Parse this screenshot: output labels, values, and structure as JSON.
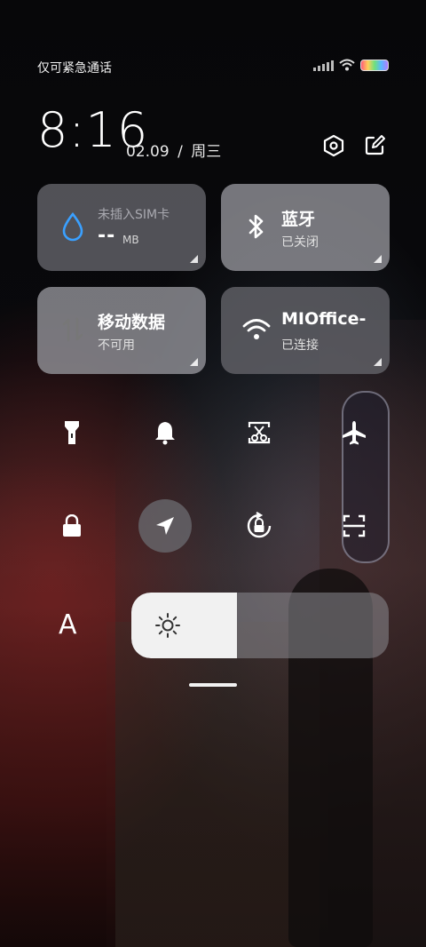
{
  "status_bar": {
    "carrier_text": "仅可紧急通话",
    "icons": [
      "signal-icon",
      "wifi-icon",
      "battery-icon"
    ]
  },
  "header": {
    "time": "8:16",
    "date": "02.09",
    "separator": "/",
    "weekday": "周三",
    "buttons": [
      "settings-icon",
      "edit-icon"
    ]
  },
  "tiles": {
    "sim": {
      "title": "未插入SIM卡",
      "value": "--",
      "unit": "MB",
      "icon": "water-drop-icon",
      "accent": "#3aa0ff"
    },
    "bluetooth": {
      "title": "蓝牙",
      "status": "已关闭",
      "icon": "bluetooth-icon"
    },
    "mobile_data": {
      "title": "移动数据",
      "status": "不可用",
      "icon": "data-arrows-icon"
    },
    "wlan": {
      "title": "MIOffice-",
      "status": "已连接",
      "icon": "wifi-icon"
    }
  },
  "toggles_row1": [
    "flashlight-icon",
    "bell-icon",
    "scissors-screenshot-icon",
    "airplane-icon"
  ],
  "toggles_row2": [
    "lock-icon",
    "location-arrow-icon",
    "rotation-lock-icon",
    "scan-icon"
  ],
  "brightness": {
    "level": 0.41,
    "icon": "sun-icon",
    "font_size_label": "A"
  }
}
